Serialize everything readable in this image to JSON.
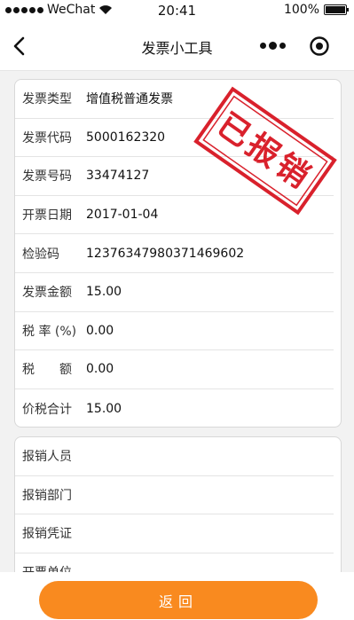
{
  "status_bar": {
    "carrier": "WeChat",
    "time": "20:41",
    "battery": "100%"
  },
  "nav": {
    "title": "发票小工具"
  },
  "invoice": {
    "rows": [
      {
        "label": "发票类型",
        "value": "增值税普通发票"
      },
      {
        "label": "发票代码",
        "value": "5000162320"
      },
      {
        "label": "发票号码",
        "value": "33474127"
      },
      {
        "label": "开票日期",
        "value": "2017-01-04"
      },
      {
        "label": "检验码",
        "value": "12376347980371469602"
      },
      {
        "label": "发票金额",
        "value": "15.00"
      },
      {
        "label": "税 率 (%)",
        "value": "0.00"
      },
      {
        "label": "税　　额",
        "value": "0.00"
      },
      {
        "label": "价税合计",
        "value": "15.00"
      }
    ],
    "stamp_text": "已报销",
    "stamp_color": "#d9212c"
  },
  "reimburse": {
    "rows": [
      {
        "label": "报销人员"
      },
      {
        "label": "报销部门"
      },
      {
        "label": "报销凭证"
      },
      {
        "label": "开票单位"
      }
    ]
  },
  "footer": {
    "button_label": "返回",
    "button_color": "#f98a1f"
  }
}
